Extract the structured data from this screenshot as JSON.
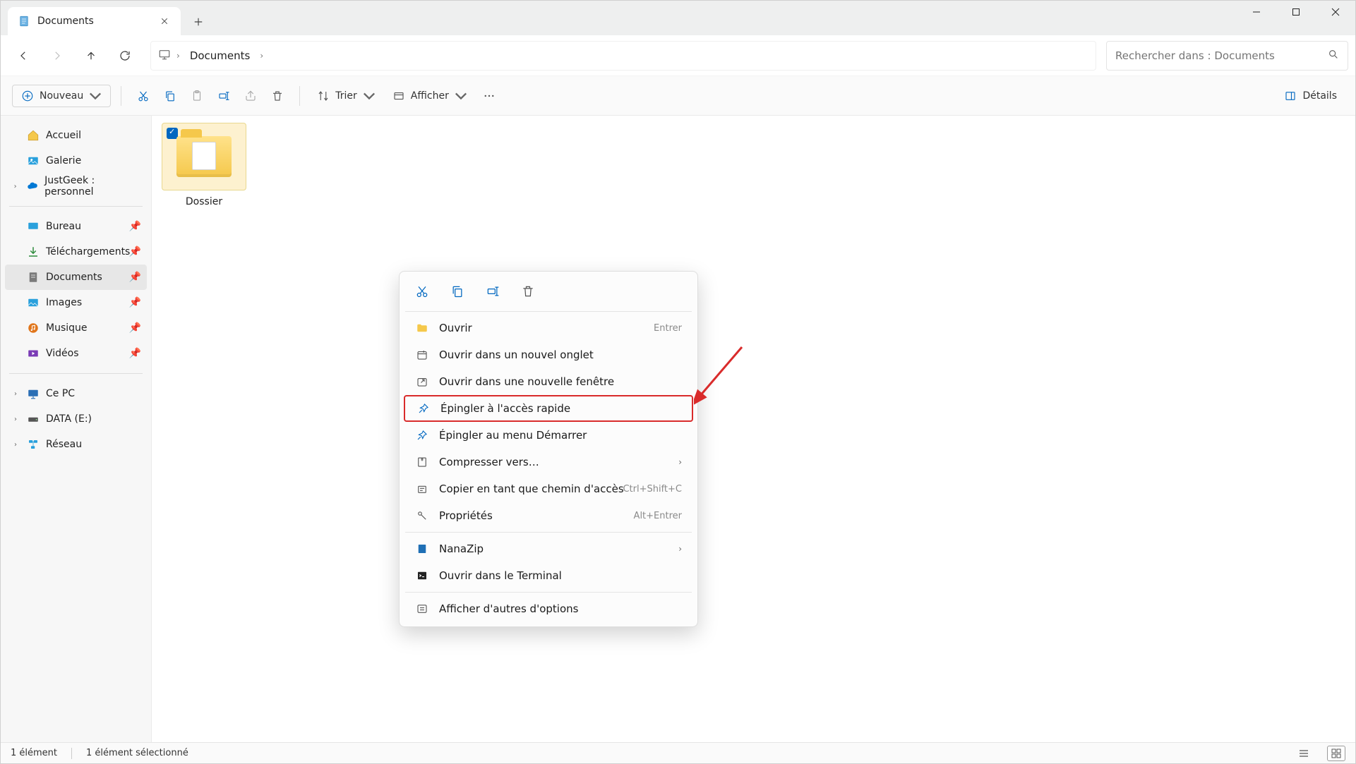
{
  "tab": {
    "title": "Documents"
  },
  "breadcrumb": {
    "current": "Documents"
  },
  "search": {
    "placeholder": "Rechercher dans : Documents"
  },
  "toolbar": {
    "new": "Nouveau",
    "sort": "Trier",
    "view": "Afficher",
    "details": "Détails"
  },
  "sidebar": {
    "quick": [
      {
        "label": "Accueil"
      },
      {
        "label": "Galerie"
      },
      {
        "label": "JustGeek : personnel"
      }
    ],
    "pinned": [
      {
        "label": "Bureau"
      },
      {
        "label": "Téléchargements"
      },
      {
        "label": "Documents"
      },
      {
        "label": "Images"
      },
      {
        "label": "Musique"
      },
      {
        "label": "Vidéos"
      }
    ],
    "drives": [
      {
        "label": "Ce PC"
      },
      {
        "label": "DATA (E:)"
      },
      {
        "label": "Réseau"
      }
    ]
  },
  "item": {
    "label": "Dossier"
  },
  "ctx": {
    "open": "Ouvrir",
    "open_sc": "Entrer",
    "open_tab": "Ouvrir dans un nouvel onglet",
    "open_win": "Ouvrir dans une nouvelle fenêtre",
    "pin_quick": "Épingler à l'accès rapide",
    "pin_start": "Épingler au menu Démarrer",
    "compress": "Compresser vers…",
    "copy_path": "Copier en tant que chemin d'accès",
    "copy_path_sc": "Ctrl+Shift+C",
    "properties": "Propriétés",
    "properties_sc": "Alt+Entrer",
    "nanazip": "NanaZip",
    "terminal": "Ouvrir dans le Terminal",
    "more": "Afficher d'autres d'options"
  },
  "status": {
    "count": "1 élément",
    "selected": "1 élément sélectionné"
  }
}
